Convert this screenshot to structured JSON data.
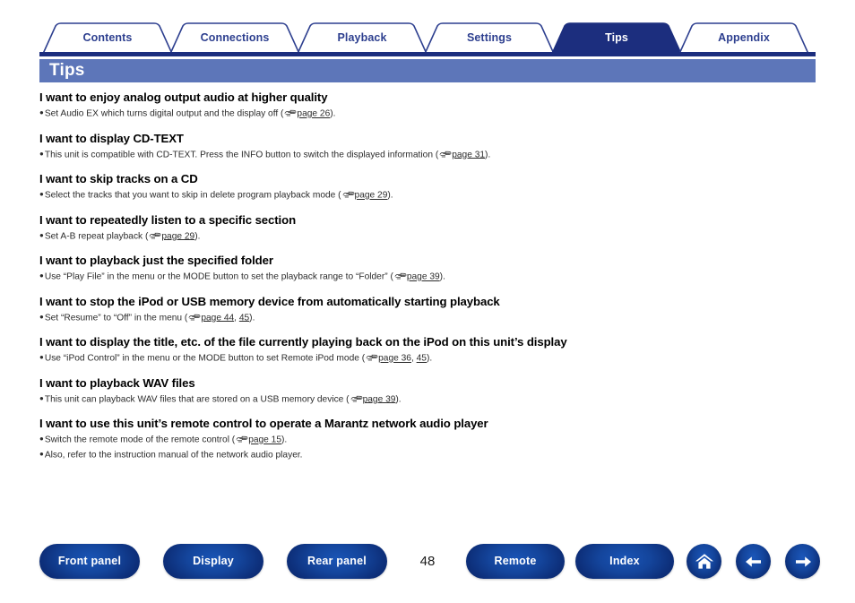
{
  "document": {
    "title": "Tips",
    "page_number": "48"
  },
  "tabs": [
    {
      "label": "Contents",
      "active": false
    },
    {
      "label": "Connections",
      "active": false
    },
    {
      "label": "Playback",
      "active": false
    },
    {
      "label": "Settings",
      "active": false
    },
    {
      "label": "Tips",
      "active": true
    },
    {
      "label": "Appendix",
      "active": false
    }
  ],
  "tips": [
    {
      "heading": "I want to enjoy analog output audio at higher quality",
      "bullets": [
        {
          "pre": "Set Audio EX which turns digital output and the display off (",
          "icon": "pointing-hand-icon",
          "links": [
            "page 26"
          ],
          "post": ")."
        }
      ]
    },
    {
      "heading": "I want to display CD-TEXT",
      "bullets": [
        {
          "pre": "This unit is compatible with CD-TEXT. Press the INFO button to switch the displayed information (",
          "icon": "pointing-hand-icon",
          "links": [
            "page 31"
          ],
          "post": ")."
        }
      ]
    },
    {
      "heading": "I want to skip tracks on a CD",
      "bullets": [
        {
          "pre": "Select the tracks that you want to skip in delete program playback mode (",
          "icon": "pointing-hand-icon",
          "links": [
            "page 29"
          ],
          "post": ")."
        }
      ]
    },
    {
      "heading": "I want to repeatedly listen to a specific section",
      "bullets": [
        {
          "pre": "Set A-B repeat playback (",
          "icon": "pointing-hand-icon",
          "links": [
            "page 29"
          ],
          "post": ")."
        }
      ]
    },
    {
      "heading": "I want to playback just the specified folder",
      "bullets": [
        {
          "pre": "Use “Play File” in the menu or the MODE button to set the playback range to “Folder” (",
          "icon": "pointing-hand-icon",
          "links": [
            "page 39"
          ],
          "post": ")."
        }
      ]
    },
    {
      "heading": "I want to stop the iPod or USB memory device from automatically starting playback",
      "bullets": [
        {
          "pre": "Set “Resume” to “Off” in the menu (",
          "icon": "pointing-hand-icon",
          "links": [
            "page 44",
            "45"
          ],
          "post": ")."
        }
      ]
    },
    {
      "heading": "I want to display the title, etc. of the file currently playing back on the iPod on this unit’s display",
      "bullets": [
        {
          "pre": "Use “iPod Control” in the menu or the MODE button to set Remote iPod mode (",
          "icon": "pointing-hand-icon",
          "links": [
            "page 36",
            "45"
          ],
          "post": ")."
        }
      ]
    },
    {
      "heading": "I want to playback WAV files",
      "bullets": [
        {
          "pre": "This unit can playback WAV files that are stored on a USB memory device (",
          "icon": "pointing-hand-icon",
          "links": [
            "page 39"
          ],
          "post": ")."
        }
      ]
    },
    {
      "heading": "I want to use this unit’s remote control to operate a Marantz network audio player",
      "bullets": [
        {
          "pre": "Switch the remote mode of the remote control (",
          "icon": "pointing-hand-icon",
          "links": [
            "page 15"
          ],
          "post": ")."
        },
        {
          "pre": "Also, refer to the instruction manual of the network audio player.",
          "icon": null,
          "links": [],
          "post": ""
        }
      ]
    }
  ],
  "footer": {
    "buttons": [
      {
        "label": "Front panel"
      },
      {
        "label": "Display"
      },
      {
        "label": "Rear panel"
      },
      {
        "label": "Remote"
      },
      {
        "label": "Index"
      }
    ],
    "icon_buttons": [
      {
        "name": "home-icon"
      },
      {
        "name": "back-arrow-icon"
      },
      {
        "name": "forward-arrow-icon"
      }
    ]
  },
  "colors": {
    "tab_border": "#2d3f8f",
    "tab_active_bg": "#1c2e7e",
    "title_bar_bg": "#5d76b9",
    "underline_bar": "#1c2e7e",
    "button_blue": "#14459c"
  }
}
